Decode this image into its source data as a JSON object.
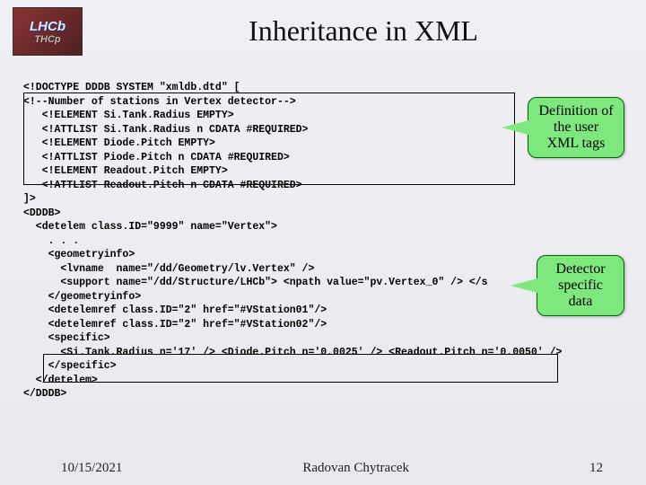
{
  "logo": {
    "main": "LHCb",
    "shadow": "THCp"
  },
  "title": "Inheritance in XML",
  "code_block": "<!DOCTYPE DDDB SYSTEM \"xmldb.dtd\" [\n<!--Number of stations in Vertex detector-->\n   <!ELEMENT Si.Tank.Radius EMPTY>\n   <!ATTLIST Si.Tank.Radius n CDATA #REQUIRED>\n   <!ELEMENT Diode.Pitch EMPTY>\n   <!ATTLIST Piode.Pitch n CDATA #REQUIRED>\n   <!ELEMENT Readout.Pitch EMPTY>\n   <!ATTLIST Readout.Pitch n CDATA #REQUIRED>\n]>\n<DDDB>\n  <detelem class.ID=\"9999\" name=\"Vertex\">\n    . . .\n    <geometryinfo>\n      <lvname  name=\"/dd/Geometry/lv.Vertex\" />\n      <support name=\"/dd/Structure/LHCb\"> <npath value=\"pv.Vertex_0\" /> </s\n    </geometryinfo>\n    <detelemref class.ID=\"2\" href=\"#VStation01\"/>\n    <detelemref class.ID=\"2\" href=\"#VStation02\"/>\n    <specific>\n      <Si.Tank.Radius n='17' /> <Diode.Pitch n='0.0025' /> <Readout.Pitch n='0.0050' />\n    </specific>\n  </detelem>\n</DDDB>",
  "callouts": {
    "definition": "Definition of the user XML tags",
    "detector": "Detector specific data"
  },
  "footer": {
    "date": "10/15/2021",
    "author": "Radovan Chytracek",
    "page": "12"
  }
}
